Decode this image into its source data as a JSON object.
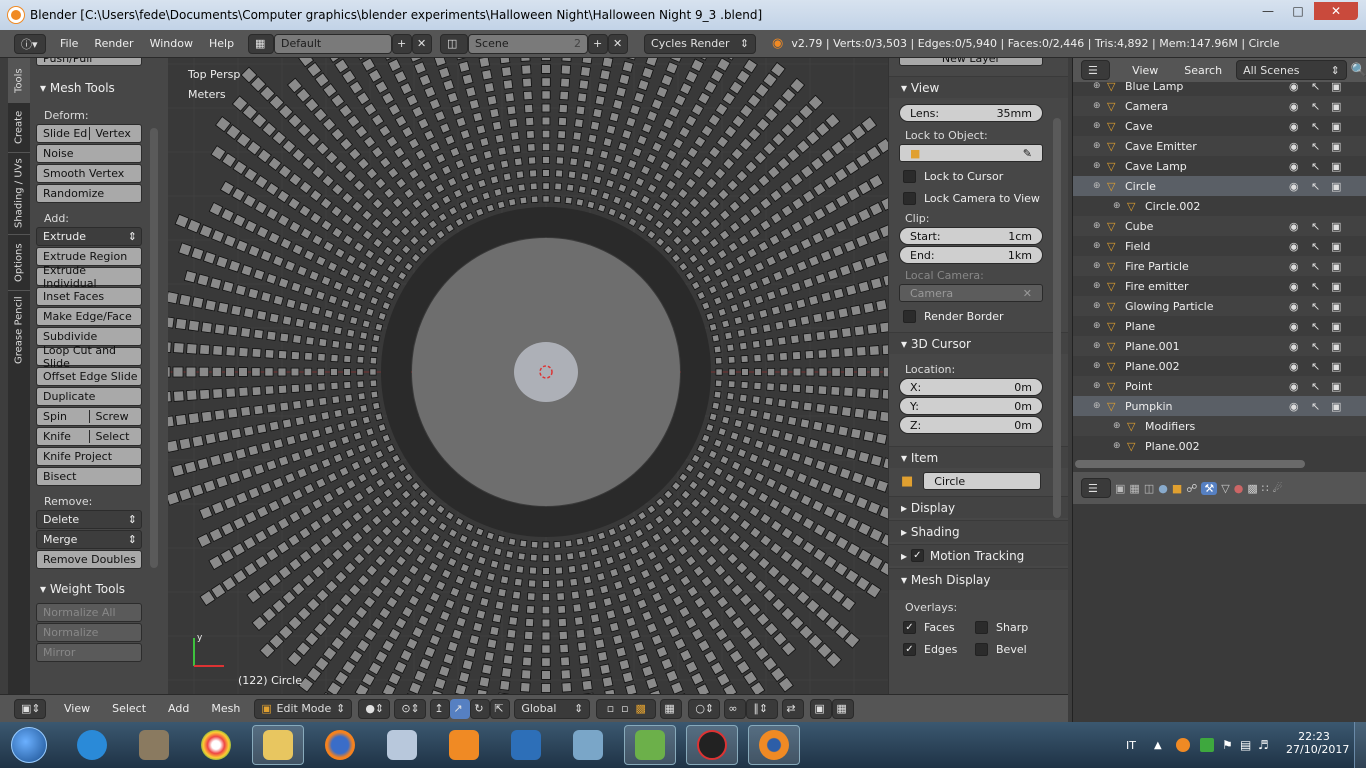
{
  "titlebar": {
    "title": "Blender [C:\\Users\\fede\\Documents\\Computer graphics\\blender experiments\\Halloween Night\\Halloween Night 9_3 .blend]"
  },
  "infobar": {
    "menus": [
      "File",
      "Render",
      "Window",
      "Help"
    ],
    "layout": "Default",
    "scene": "Scene",
    "scene_users": "2",
    "engine": "Cycles Render",
    "stats": "v2.79 | Verts:0/3,503 | Edges:0/5,940 | Faces:0/2,446 | Tris:4,892 | Mem:147.96M | Circle"
  },
  "tabs": [
    "Tools",
    "Create",
    "Shading / UVs",
    "Options",
    "Grease Pencil"
  ],
  "toolshelf": {
    "top_cut": "Push/Pull",
    "mesh_tools": "Mesh Tools",
    "deform": "Deform:",
    "slide_edge": "Slide Ed",
    "vertex": "Vertex",
    "noise": "Noise",
    "smooth_vertex": "Smooth Vertex",
    "randomize": "Randomize",
    "add": "Add:",
    "extrude": "Extrude",
    "extrude_region": "Extrude Region",
    "extrude_individual": "Extrude Individual",
    "inset_faces": "Inset Faces",
    "make_edge_face": "Make Edge/Face",
    "subdivide": "Subdivide",
    "loop_cut": "Loop Cut and Slide",
    "offset_edge_slide": "Offset Edge Slide",
    "duplicate": "Duplicate",
    "spin": "Spin",
    "screw": "Screw",
    "knife": "Knife",
    "select": "Select",
    "knife_project": "Knife Project",
    "bisect": "Bisect",
    "remove": "Remove:",
    "delete": "Delete",
    "merge": "Merge",
    "remove_doubles": "Remove Doubles",
    "weight_tools": "Weight Tools",
    "normalize_all": "Normalize All",
    "normalize": "Normalize",
    "mirror": "Mirror"
  },
  "viewport": {
    "view_name": "Top Persp",
    "units": "Meters",
    "object_info": "(122) Circle",
    "axis_y": "y"
  },
  "npanel": {
    "new_layer": "New Layer",
    "view": "View",
    "lens_label": "Lens:",
    "lens_value": "35mm",
    "lock_to_object": "Lock to Object:",
    "lock_to_cursor": "Lock to Cursor",
    "lock_camera": "Lock Camera to View",
    "clip": "Clip:",
    "start_label": "Start:",
    "start_value": "1cm",
    "end_label": "End:",
    "end_value": "1km",
    "local_camera": "Local Camera:",
    "camera": "Camera",
    "render_border": "Render Border",
    "cursor": "3D Cursor",
    "location": "Location:",
    "x_label": "X:",
    "x_value": "0m",
    "y_label": "Y:",
    "y_value": "0m",
    "z_label": "Z:",
    "z_value": "0m",
    "item": "Item",
    "item_name": "Circle",
    "display": "Display",
    "shading": "Shading",
    "motion_tracking": "Motion Tracking",
    "mesh_display": "Mesh Display",
    "overlays": "Overlays:",
    "faces": "Faces",
    "sharp": "Sharp",
    "edges": "Edges",
    "bevel": "Bevel"
  },
  "outliner": {
    "view": "View",
    "search": "Search",
    "filter": "All Scenes",
    "rows": [
      {
        "name": "Blue Lamp",
        "indent": 0,
        "hl": false
      },
      {
        "name": "Camera",
        "indent": 0,
        "hl": false
      },
      {
        "name": "Cave",
        "indent": 0,
        "hl": false
      },
      {
        "name": "Cave Emitter",
        "indent": 0,
        "hl": false
      },
      {
        "name": "Cave Lamp",
        "indent": 0,
        "hl": false
      },
      {
        "name": "Circle",
        "indent": 0,
        "hl": true
      },
      {
        "name": "Circle.002",
        "indent": 1,
        "hl": false
      },
      {
        "name": "Cube",
        "indent": 0,
        "hl": false
      },
      {
        "name": "Field",
        "indent": 0,
        "hl": false
      },
      {
        "name": "Fire Particle",
        "indent": 0,
        "hl": false
      },
      {
        "name": "Fire emitter",
        "indent": 0,
        "hl": false
      },
      {
        "name": "Glowing Particle",
        "indent": 0,
        "hl": false
      },
      {
        "name": "Plane",
        "indent": 0,
        "hl": false
      },
      {
        "name": "Plane.001",
        "indent": 0,
        "hl": false
      },
      {
        "name": "Plane.002",
        "indent": 0,
        "hl": false
      },
      {
        "name": "Point",
        "indent": 0,
        "hl": false
      },
      {
        "name": "Pumpkin",
        "indent": 0,
        "hl": true
      },
      {
        "name": "Modifiers",
        "indent": 1,
        "hl": false
      },
      {
        "name": "Plane.002",
        "indent": 1,
        "hl": false
      }
    ]
  },
  "bottombar": {
    "view": "View",
    "select": "Select",
    "add": "Add",
    "mesh": "Mesh",
    "mode": "Edit Mode",
    "orientation": "Global"
  },
  "taskbar": {
    "lang": "IT",
    "time": "22:23",
    "date": "27/10/2017"
  }
}
